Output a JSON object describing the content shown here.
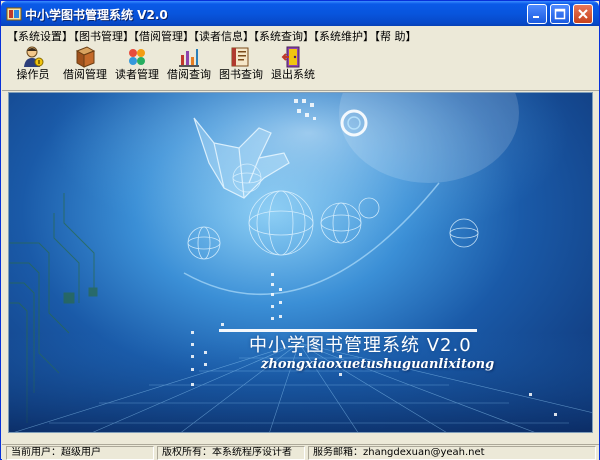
{
  "window": {
    "title": "中小学图书管理系统 V2.0"
  },
  "menubar": {
    "items": [
      {
        "label": "【系统设置】"
      },
      {
        "label": "【图书管理】"
      },
      {
        "label": "【借阅管理】"
      },
      {
        "label": "【读者信息】"
      },
      {
        "label": "【系统查询】"
      },
      {
        "label": "【系统维护】"
      },
      {
        "label": "【帮 助】"
      }
    ]
  },
  "toolbar": {
    "items": [
      {
        "label": "操作员",
        "icon": "operator-icon"
      },
      {
        "label": "借阅管理",
        "icon": "book-brown-icon"
      },
      {
        "label": "读者管理",
        "icon": "readers-icon"
      },
      {
        "label": "借阅查询",
        "icon": "chart-bars-icon"
      },
      {
        "label": "图书查询",
        "icon": "book-open-icon"
      },
      {
        "label": "退出系统",
        "icon": "exit-icon"
      }
    ]
  },
  "banner": {
    "title": "中小学图书管理系统 V2.0",
    "subtitle": "zhongxiaoxuetushuguanlixitong"
  },
  "statusbar": {
    "current_user": "当前用户：超级用户",
    "copyright": "版权所有：本系统程序设计者",
    "email": "服务邮箱：zhangdexuan@yeah.net"
  },
  "colors": {
    "titlebar": "#0855dd",
    "background": "#ece9d8",
    "banner_dark": "#0d2f6e",
    "banner_light": "#8fd0f5"
  }
}
